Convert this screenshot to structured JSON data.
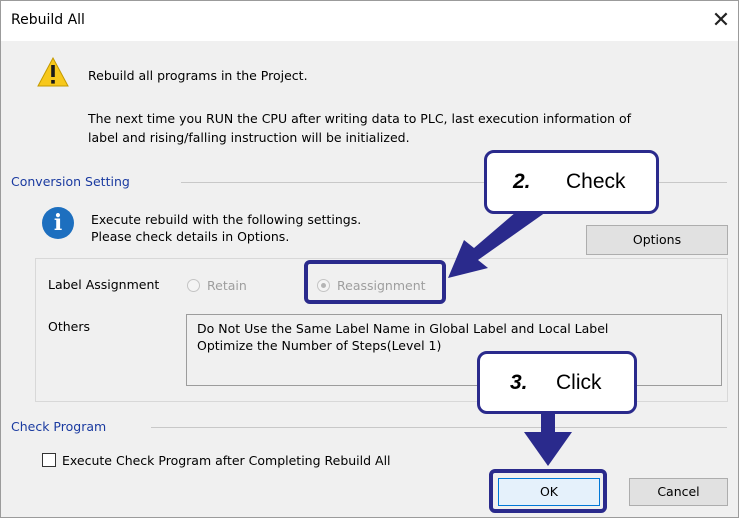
{
  "dialog": {
    "title": "Rebuild All",
    "close_glyph": "✕",
    "warning_line1": "Rebuild all programs in the Project.",
    "warning_line2": "The next time you RUN the CPU after writing data to PLC, last execution information of",
    "warning_line3": "label and rising/falling instruction will be initialized."
  },
  "conversion": {
    "group_label": "Conversion Setting",
    "info_line1": "Execute rebuild with the following settings.",
    "info_line2": "Please check details in Options.",
    "options_button": "Options",
    "label_assignment_label": "Label Assignment",
    "radio_retain": "Retain",
    "radio_reassignment": "Reassignment",
    "selected": "Reassignment",
    "others_label": "Others",
    "others_line1": "Do Not Use the Same Label Name in Global Label and Local Label",
    "others_line2": "Optimize the Number of Steps(Level 1)"
  },
  "check_program": {
    "group_label": "Check Program",
    "checkbox_label": "Execute Check Program after Completing Rebuild All",
    "checked": false
  },
  "buttons": {
    "ok": "OK",
    "cancel": "Cancel"
  },
  "annotations": {
    "step2_number": "2.",
    "step2_text": "Check",
    "step3_number": "3.",
    "step3_text": "Click",
    "color": "#2a2a8c"
  },
  "icons": {
    "warning": "warning-icon",
    "info": "info-icon",
    "close": "close-icon"
  }
}
